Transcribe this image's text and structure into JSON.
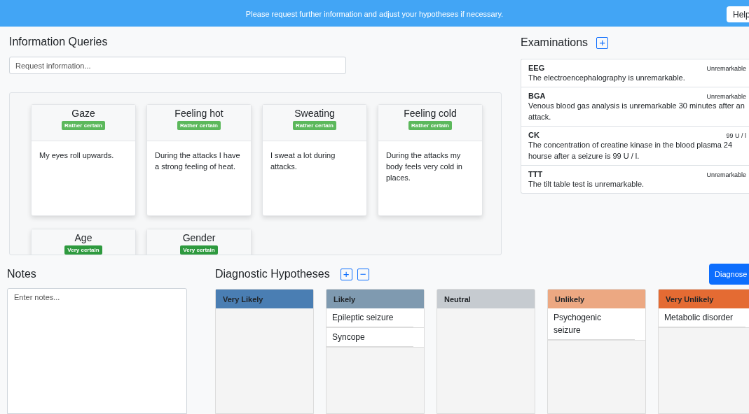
{
  "banner": {
    "message": "Please request further information and adjust your hypotheses if necessary.",
    "help_button": "Help"
  },
  "information_queries": {
    "title": "Information Queries",
    "search": {
      "placeholder": "Request information..."
    },
    "cards": [
      {
        "title": "Gaze",
        "badge": {
          "label": "Rather certain",
          "color": "#5cb85c"
        },
        "text": "My eyes roll upwards."
      },
      {
        "title": "Feeling hot",
        "badge": {
          "label": "Rather certain",
          "color": "#5cb85c"
        },
        "text": "During the attacks I have a strong feeling of heat."
      },
      {
        "title": "Sweating",
        "badge": {
          "label": "Rather certain",
          "color": "#5cb85c"
        },
        "text": "I sweat a lot during attacks."
      },
      {
        "title": "Feeling cold",
        "badge": {
          "label": "Rather certain",
          "color": "#5cb85c"
        },
        "text": "During the attacks my body feels very cold in places."
      },
      {
        "title": "Age",
        "badge": {
          "label": "Very certain",
          "color": "#2e9a3f"
        }
      },
      {
        "title": "Gender",
        "badge": {
          "label": "Very certain",
          "color": "#2e9a3f"
        }
      }
    ]
  },
  "examinations": {
    "title": "Examinations",
    "add_button": "+",
    "items": [
      {
        "name": "EEG",
        "result": "Unremarkable",
        "text": "The electroencephalography is unremarkable."
      },
      {
        "name": "BGA",
        "result": "Unremarkable",
        "text": "Venous blood gas analysis is unremarkable 30 minutes after an attack."
      },
      {
        "name": "CK",
        "result": "99 U / l",
        "text": "The concentration of creatine kinase in the blood plasma 24 hourse after a seizure is 99 U / l."
      },
      {
        "name": "TTT",
        "result": "Unremarkable",
        "text": "The tilt table test is unremarkable."
      }
    ]
  },
  "notes": {
    "title": "Notes",
    "placeholder": "Enter notes..."
  },
  "diagnostic_hypotheses": {
    "title": "Diagnostic Hypotheses",
    "add_button": "+",
    "remove_button": "−",
    "diagnose_button": "Diagnose",
    "columns": [
      {
        "label": "Very Likely",
        "color": "#4a7eb3"
      },
      {
        "label": "Likely",
        "color": "#7f9ab0",
        "items": [
          "Epileptic seizure",
          "Syncope"
        ]
      },
      {
        "label": "Neutral",
        "color": "#c6cbd0"
      },
      {
        "label": "Unlikely",
        "color": "#eca882",
        "items": [
          "Psychogenic seizure"
        ]
      },
      {
        "label": "Very Unlikely",
        "color": "#e46b33",
        "items": [
          "Metabolic disorder"
        ]
      }
    ]
  }
}
